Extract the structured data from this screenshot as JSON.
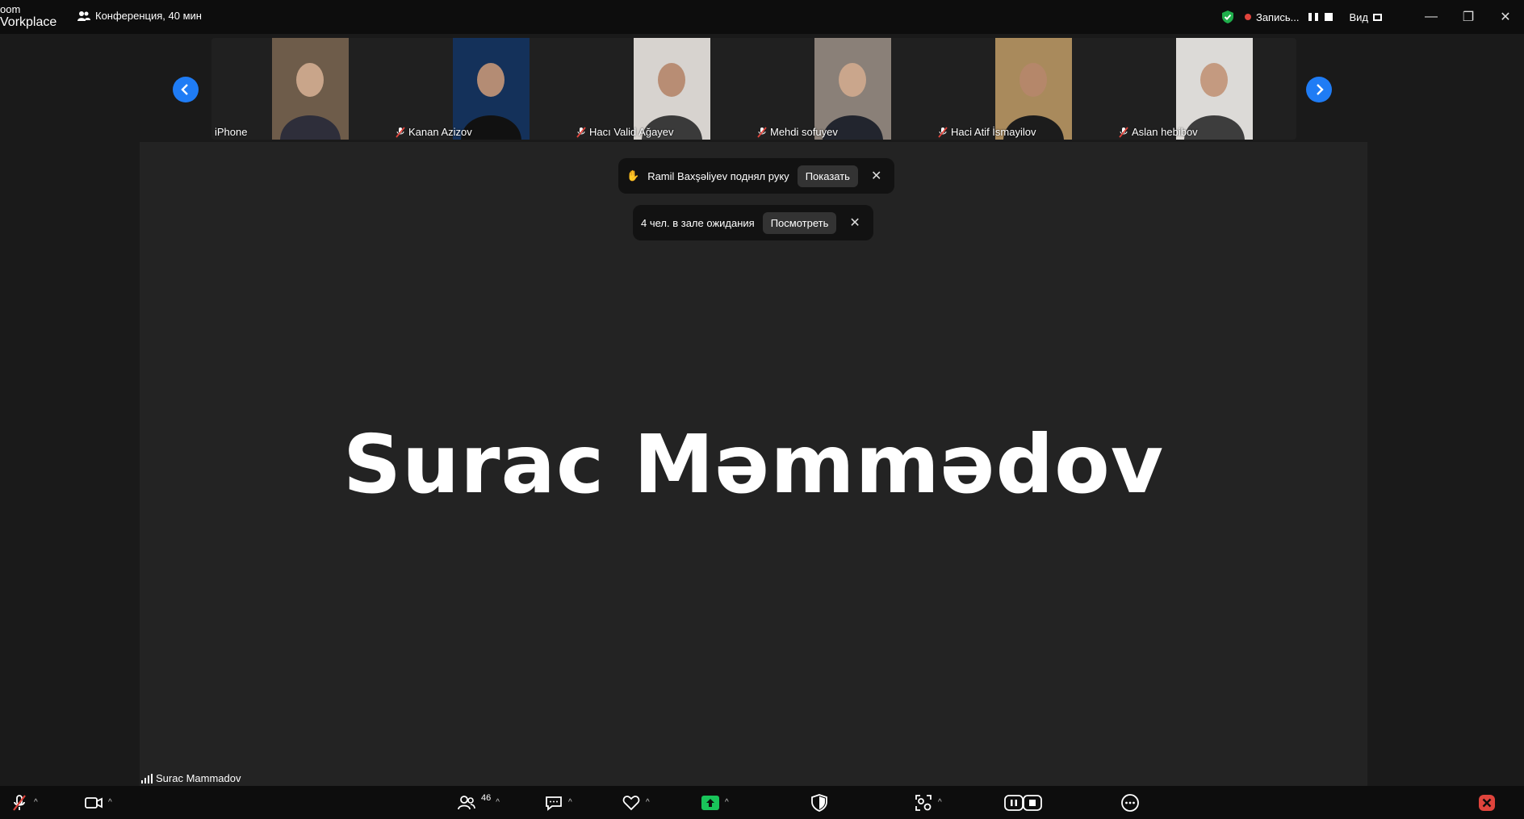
{
  "app": {
    "logo_line1": "oom",
    "logo_line2": "Vorkplace"
  },
  "meeting": {
    "title": "Конференция, 40 мин"
  },
  "recording": {
    "label": "Запись..."
  },
  "view": {
    "label": "Вид"
  },
  "participants": [
    {
      "name": "iPhone",
      "muted": false,
      "bg": "#6e5c4a",
      "face": "#c9a58a",
      "body": "#2e2e3a"
    },
    {
      "name": "Kanan Azizov",
      "muted": true,
      "bg": "#14315a",
      "face": "#b48c74",
      "body": "#111111"
    },
    {
      "name": "Hacı Valid Ağayev",
      "muted": true,
      "bg": "#d7d3cf",
      "face": "#b88d74",
      "body": "#3a3a3a"
    },
    {
      "name": "Mehdi sofuyev",
      "muted": true,
      "bg": "#8a8078",
      "face": "#caa68c",
      "body": "#22252e"
    },
    {
      "name": "Haci Atif İsmayilov",
      "muted": true,
      "bg": "#a98a5c",
      "face": "#b5876a",
      "body": "#1c1c1c"
    },
    {
      "name": "Aslan hebibov",
      "muted": true,
      "bg": "#dcdad7",
      "face": "#c49a80",
      "body": "#3d3d3d"
    }
  ],
  "notifications": {
    "raise_hand": {
      "text": "Ramil Baxşəliyev поднял руку",
      "button": "Показать",
      "icon": "✋"
    },
    "waiting_room": {
      "text": "4 чел. в зале ожидания",
      "button": "Посмотреть"
    }
  },
  "speaker": {
    "display_name": "Surac Məmmədov",
    "label": "Surac Mammadov"
  },
  "toolbar": {
    "participants_count": "46"
  },
  "colors": {
    "accent": "#1f7cf5",
    "share_green": "#19c45a",
    "end_red": "#e0443c"
  }
}
